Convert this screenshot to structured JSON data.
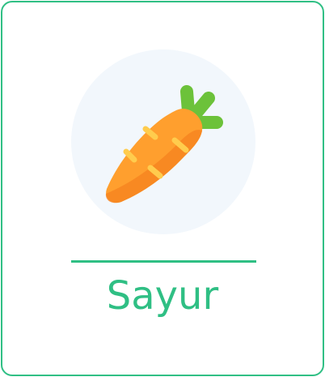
{
  "category": {
    "label": "Sayur",
    "icon": "carrot-icon"
  },
  "colors": {
    "accent": "#2fbf84",
    "icon_background": "#f2f7fc",
    "carrot_orange": "#ff9f2e",
    "carrot_shadow": "#f5811f",
    "carrot_lines": "#ffcc4d",
    "leaf_green": "#6cc23a"
  }
}
